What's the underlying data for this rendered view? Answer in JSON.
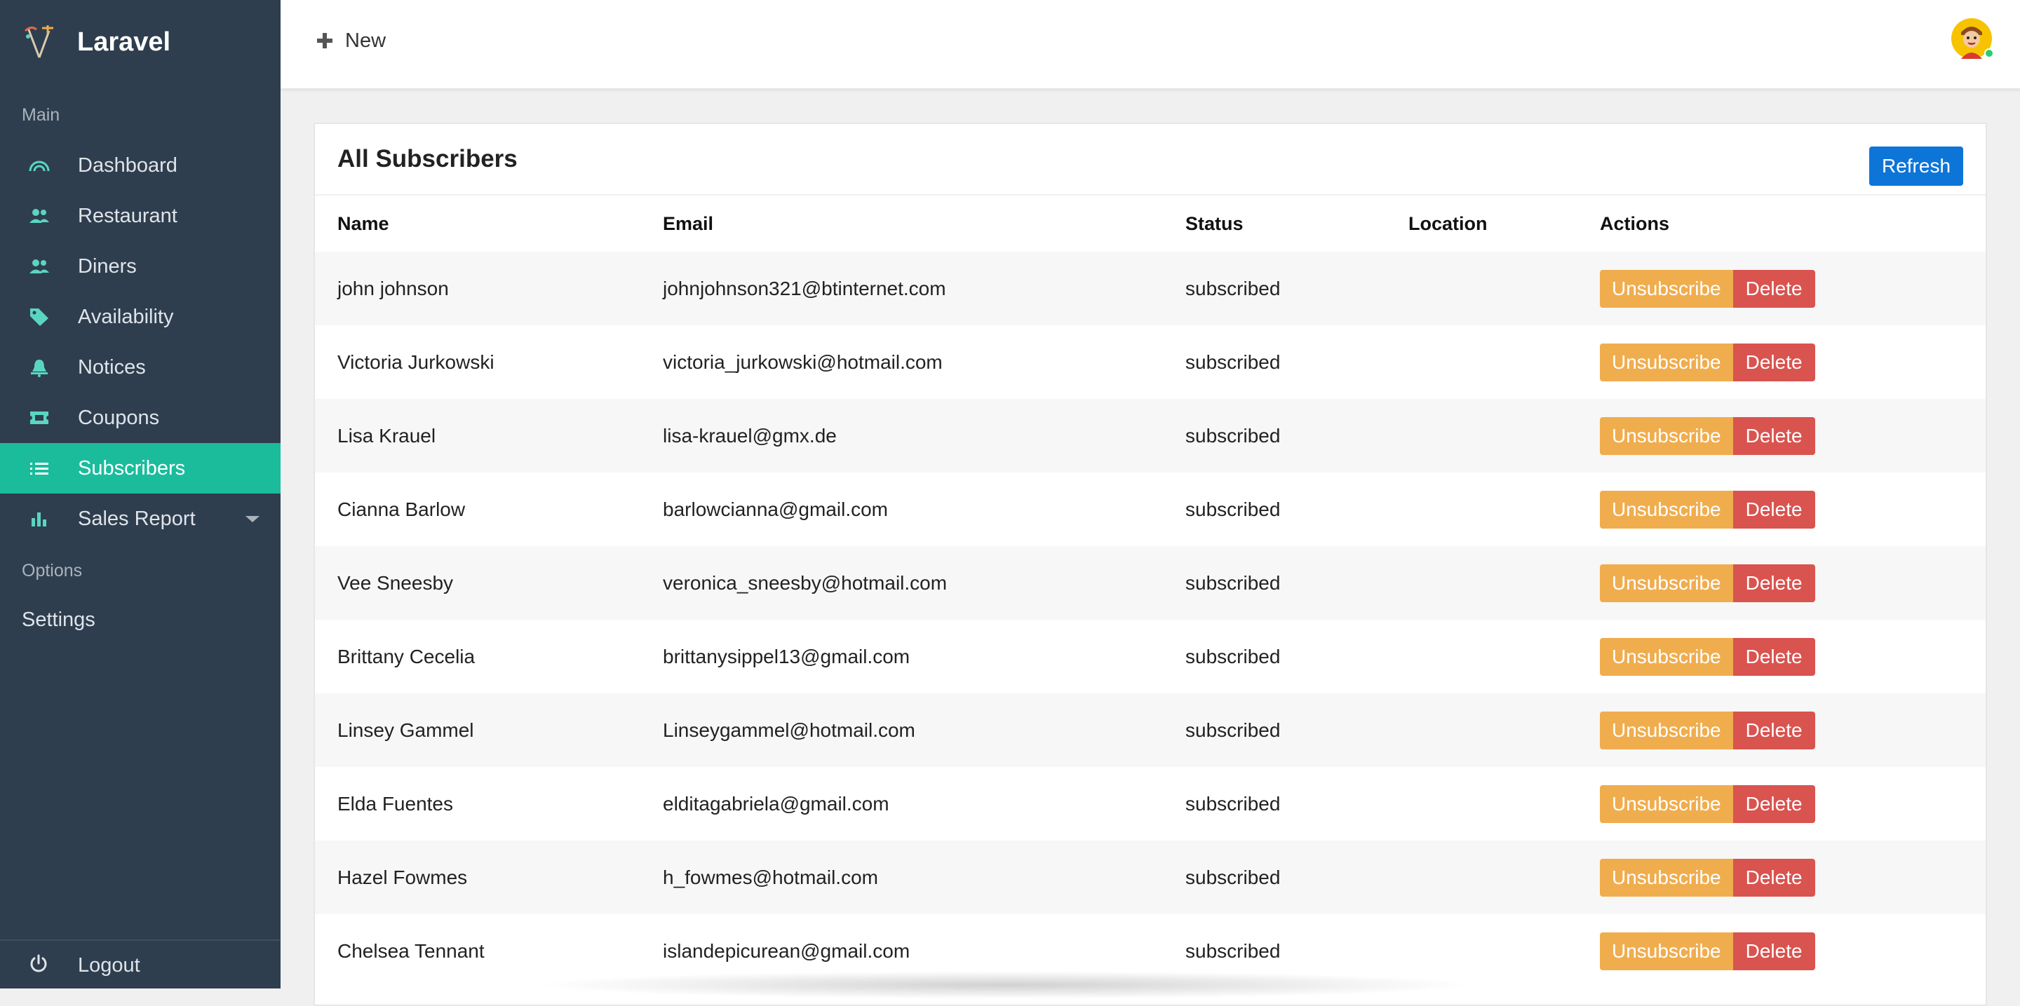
{
  "app": {
    "name": "Laravel"
  },
  "sidebar": {
    "section_main": "Main",
    "items": [
      {
        "label": "Dashboard",
        "icon": "dashboard-gauge-icon"
      },
      {
        "label": "Restaurant",
        "icon": "users-icon"
      },
      {
        "label": "Diners",
        "icon": "users-icon"
      },
      {
        "label": "Availability",
        "icon": "tag-icon"
      },
      {
        "label": "Notices",
        "icon": "bell-icon"
      },
      {
        "label": "Coupons",
        "icon": "ticket-icon"
      },
      {
        "label": "Subscribers",
        "icon": "list-icon",
        "active": true
      },
      {
        "label": "Sales Report",
        "icon": "bar-chart-icon",
        "has_submenu": true
      }
    ],
    "section_options": "Options",
    "settings_label": "Settings",
    "logout_label": "Logout"
  },
  "topbar": {
    "new_label": "New"
  },
  "card": {
    "title": "All Subscribers",
    "refresh_label": "Refresh"
  },
  "table": {
    "headers": {
      "name": "Name",
      "email": "Email",
      "status": "Status",
      "location": "Location",
      "actions": "Actions"
    },
    "unsubscribe_label": "Unsubscribe",
    "delete_label": "Delete",
    "rows": [
      {
        "name": "john johnson",
        "email": "johnjohnson321@btinternet.com",
        "status": "subscribed",
        "location": ""
      },
      {
        "name": "Victoria Jurkowski",
        "email": "victoria_jurkowski@hotmail.com",
        "status": "subscribed",
        "location": ""
      },
      {
        "name": "Lisa Krauel",
        "email": "lisa-krauel@gmx.de",
        "status": "subscribed",
        "location": ""
      },
      {
        "name": "Cianna Barlow",
        "email": "barlowcianna@gmail.com",
        "status": "subscribed",
        "location": ""
      },
      {
        "name": "Vee Sneesby",
        "email": "veronica_sneesby@hotmail.com",
        "status": "subscribed",
        "location": ""
      },
      {
        "name": "Brittany Cecelia",
        "email": "brittanysippel13@gmail.com",
        "status": "subscribed",
        "location": ""
      },
      {
        "name": "Linsey Gammel",
        "email": "Linseygammel@hotmail.com",
        "status": "subscribed",
        "location": ""
      },
      {
        "name": "Elda Fuentes",
        "email": "elditagabriela@gmail.com",
        "status": "subscribed",
        "location": ""
      },
      {
        "name": "Hazel Fowmes",
        "email": "h_fowmes@hotmail.com",
        "status": "subscribed",
        "location": ""
      },
      {
        "name": "Chelsea Tennant",
        "email": "islandepicurean@gmail.com",
        "status": "subscribed",
        "location": ""
      }
    ]
  },
  "colors": {
    "sidebar_bg": "#2f3e4e",
    "active_item": "#1abc9c",
    "refresh": "#0d75d8",
    "unsubscribe": "#f0ad4e",
    "delete": "#d9534f",
    "icon_teal": "#5ad6c0"
  }
}
